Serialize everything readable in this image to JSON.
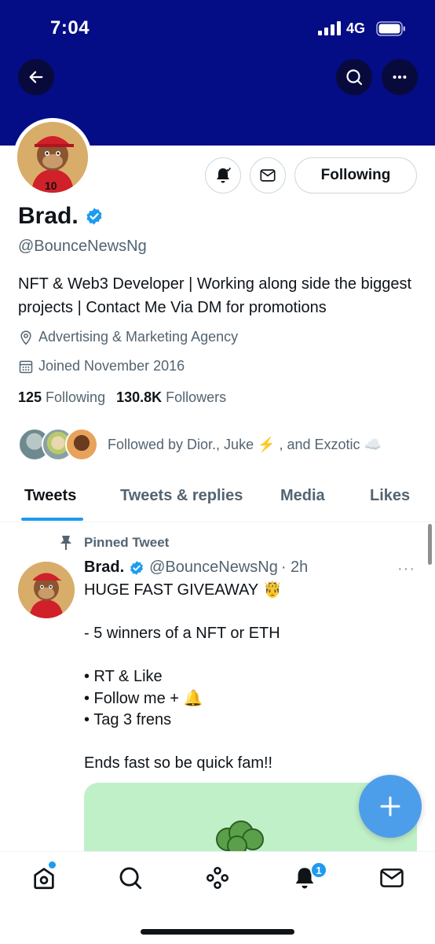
{
  "status_bar": {
    "time": "7:04",
    "network": "4G"
  },
  "profile": {
    "display_name": "Brad.",
    "handle": "@BounceNewsNg",
    "bio": "NFT & Web3 Developer | Working along side the biggest projects | Contact Me Via DM for promotions",
    "location": "Advertising & Marketing Agency",
    "joined": "Joined November 2016",
    "following_count": "125",
    "following_label": "Following",
    "followers_count": "130.8K",
    "followers_label": "Followers",
    "followed_by": "Followed by Dior., Juke ⚡️ , and Exzotic ☁️",
    "following_button": "Following"
  },
  "tabs": [
    {
      "label": "Tweets",
      "active": true
    },
    {
      "label": "Tweets & replies",
      "active": false
    },
    {
      "label": "Media",
      "active": false
    },
    {
      "label": "Likes",
      "active": false
    }
  ],
  "pinned_tweet": {
    "pinned_label": "Pinned Tweet",
    "author": "Brad.",
    "handle": "@BounceNewsNg",
    "time": "· 2h",
    "more": "···",
    "text": "HUGE FAST GIVEAWAY 🤴\n\n- 5 winners of a NFT or ETH\n\n• RT & Like\n• Follow me + 🔔\n• Tag 3 frens\n\nEnds fast so be quick fam!!"
  },
  "bottom_nav": {
    "notification_badge": "1",
    "items": [
      "home-icon",
      "search-icon",
      "spaces-icon",
      "notifications-icon",
      "messages-icon"
    ]
  },
  "colors": {
    "banner": "#040c86",
    "accent": "#1d9bf0",
    "fab": "#4c9eeb",
    "muted_text": "#536471"
  }
}
